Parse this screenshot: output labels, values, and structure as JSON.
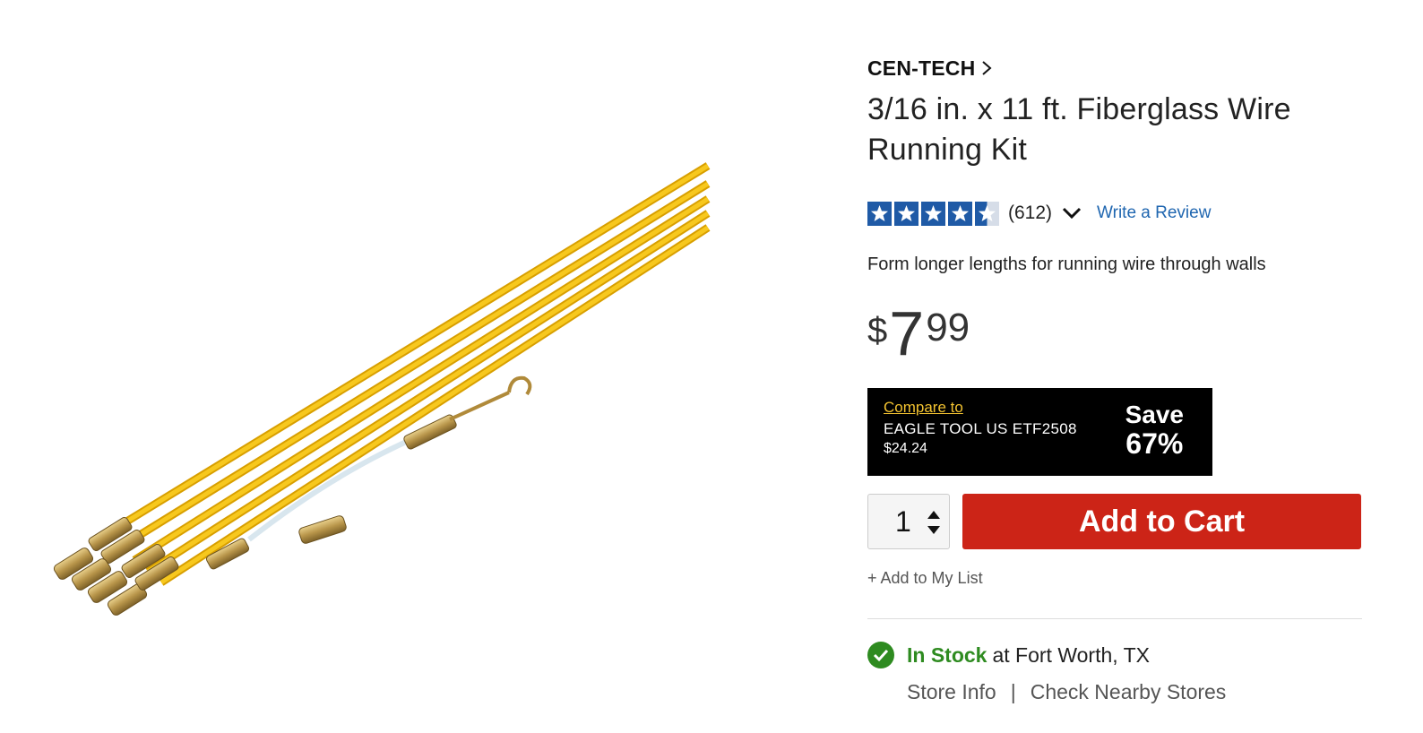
{
  "product": {
    "brand": "CEN-TECH",
    "title": "3/16 in. x 11 ft. Fiberglass Wire Running Kit",
    "rating": 4.5,
    "review_count": "(612)",
    "write_review": "Write a Review",
    "description": "Form longer lengths for running wire through walls",
    "price": {
      "currency": "$",
      "dollars": "7",
      "cents": "99"
    },
    "compare": {
      "link_label": "Compare to",
      "name": "EAGLE TOOL US ETF2508",
      "price": "$24.24",
      "save_label": "Save",
      "save_percent": "67%"
    },
    "quantity": "1",
    "add_to_cart": "Add to Cart",
    "add_to_list": "+ Add to My List",
    "stock": {
      "status": "In Stock",
      "location": "at Fort Worth, TX",
      "store_info": "Store Info",
      "separator": "|",
      "check_nearby": "Check Nearby Stores"
    }
  },
  "colors": {
    "cart_red": "#cc2417",
    "star_blue": "#1f5aa6",
    "stock_green": "#2e8b20",
    "compare_yellow": "#f2c230",
    "rod_yellow": "#f2b400"
  },
  "icons": [
    "chevron-right-icon",
    "star-icon",
    "chevron-down-icon",
    "arrow-up-icon",
    "arrow-down-icon",
    "check-circle-icon"
  ]
}
